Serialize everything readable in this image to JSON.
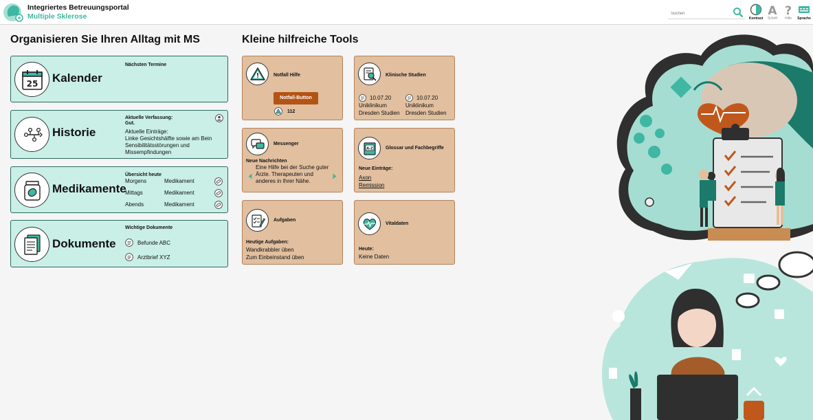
{
  "header": {
    "title": "Integriertes Betreuungsportal",
    "subtitle": "Multiple Sklerose",
    "search_placeholder": "Suchen",
    "buttons": [
      {
        "label": "Kontrast",
        "icon": "contrast-icon"
      },
      {
        "label": "Schrift",
        "icon": "font-icon"
      },
      {
        "label": "Hilfe",
        "icon": "help-icon"
      },
      {
        "label": "Sprache",
        "icon": "language-icon"
      }
    ]
  },
  "left": {
    "title": "Organisieren Sie Ihren Alltag mit MS",
    "kalender": {
      "title": "Kalender",
      "icon_day": "25",
      "info_head": "Nächsten Termine"
    },
    "historie": {
      "title": "Historie",
      "info_head": "Aktuelle Verfassung:",
      "status": "Gut.",
      "entries_head": "Aktuelle Einträge:",
      "entries_text": "Linke Gesichtshälfte sowie am Bein Sensibilitätsstörungen und Missempfindungen"
    },
    "medikamente": {
      "title": "Medikamente",
      "info_head": "Übersicht heute",
      "rows": [
        {
          "time": "Morgens",
          "med": "Medikament"
        },
        {
          "time": "Mittags",
          "med": "Medikament"
        },
        {
          "time": "Abends",
          "med": "Medikament"
        }
      ]
    },
    "dokumente": {
      "title": "Dokumente",
      "info_head": "Wichtige Dokumente",
      "docs": [
        "Befunde ABC",
        "Arztbrief XYZ"
      ]
    }
  },
  "tools": {
    "title": "Kleine hilfreiche Tools",
    "notfall": {
      "title": "Notfall Hilfe",
      "button": "Notfall-Button",
      "number": "112"
    },
    "studien": {
      "title": "Klinische Studien",
      "items": [
        {
          "date": "10.07.20",
          "line1": "Uniklinikum",
          "line2": "Dresden Studien"
        },
        {
          "date": "10.07.20",
          "line1": "Uniklinikum",
          "line2": "Dresden Studien"
        }
      ]
    },
    "messenger": {
      "title": "Messenger",
      "head": "Neue Nachrichten",
      "text": "Eine Hilfe bei der Suche guter Ärzte. Therapeuten und anderes in Ihrer Nähe."
    },
    "glossar": {
      "title": "Glossar und Fachbegriffe",
      "head": "Neue Einträge:",
      "links": [
        "Axon",
        "Remission"
      ],
      "icon_text": "A-Z"
    },
    "aufgaben": {
      "title": "Aufgaben",
      "head": "Heutige Aufgaben:",
      "items": [
        "Wandkrabbler üben",
        "Zum Einbeinstand üben"
      ]
    },
    "vitaldaten": {
      "title": "Vitaldaten",
      "head": "Heute:",
      "text": "Keine Daten"
    }
  },
  "colors": {
    "mint": "#c9efe7",
    "teal": "#3fb7a3",
    "tan": "#e1bf9f",
    "rust": "#b35414"
  }
}
